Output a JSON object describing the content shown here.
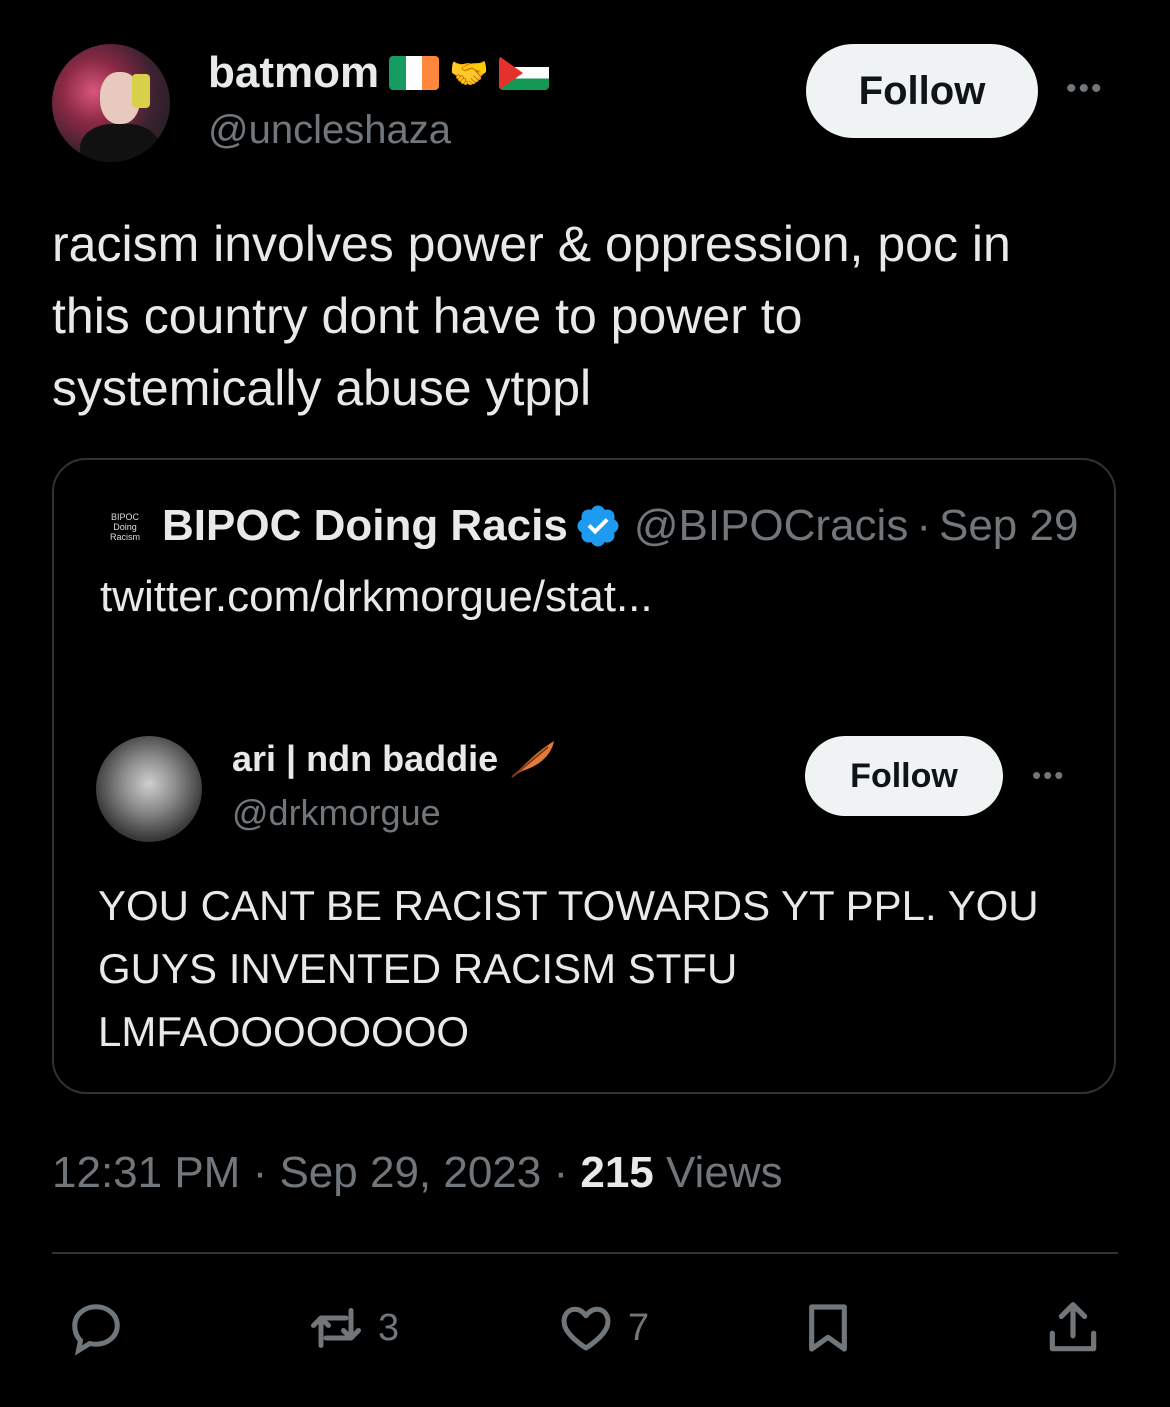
{
  "author": {
    "display_name": "batmom",
    "flags": [
      "ireland-flag",
      "handshake-icon",
      "palestine-flag"
    ],
    "handle": "@uncleshaza"
  },
  "follow_label": "Follow",
  "tweet": {
    "lines": [
      "racism involves power & oppression, poc in",
      "this country dont have to power to",
      "systemically abuse ytppl"
    ]
  },
  "quote": {
    "avatar_text": [
      "BIPOC",
      "Doing",
      "Racism"
    ],
    "name": "BIPOC Doing Racis",
    "handle": "@BIPOCracis",
    "separator": "·",
    "date": "Sep 29",
    "link": "twitter.com/drkmorgue/stat...",
    "embedded": {
      "name": "ari | ndn baddie",
      "handle": "@drkmorgue",
      "follow_label": "Follow",
      "lines": [
        "YOU CANT BE RACIST TOWARDS YT PPL. YOU",
        "GUYS INVENTED RACISM STFU",
        "LMFAOOOOOOOO"
      ]
    }
  },
  "meta": {
    "time": "12:31 PM",
    "sep1": " · ",
    "date": "Sep 29, 2023",
    "sep2": " · ",
    "views_count": "215",
    "views_label": " Views"
  },
  "actions": {
    "reply_count": "",
    "retweet_count": "3",
    "like_count": "7"
  },
  "colors": {
    "background": "#000000",
    "text": "#e7e9ea",
    "secondary": "#71767b",
    "verified": "#1d9bf0",
    "border": "#2f3336",
    "button": "#eff3f4"
  }
}
